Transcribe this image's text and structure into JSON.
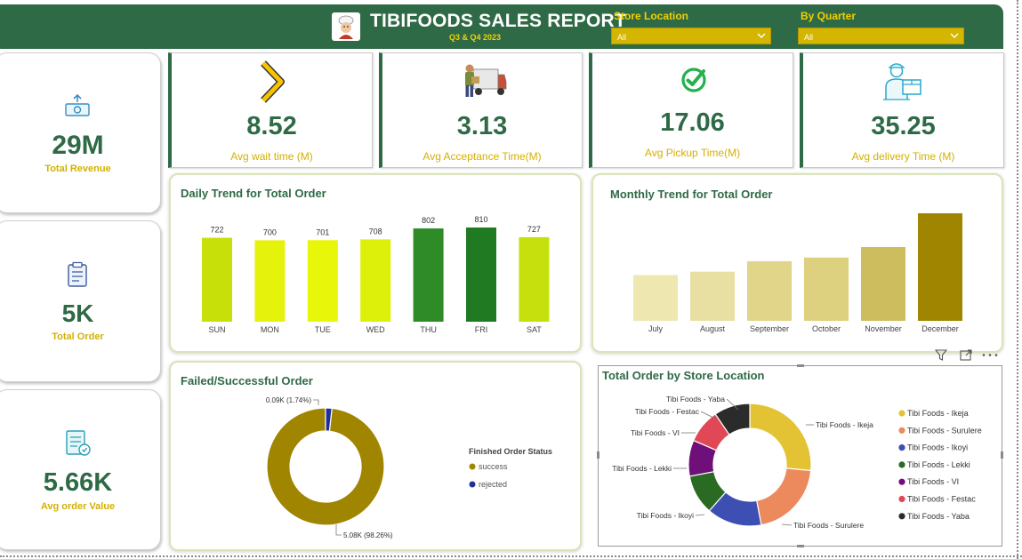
{
  "header": {
    "title": "TIBIFOODS SALES REPORT",
    "subtitle": "Q3 & Q4 2023",
    "logo_icon": "chef-logo-icon"
  },
  "slicers": [
    {
      "label": "Store Location",
      "value": "All"
    },
    {
      "label": "By Quarter",
      "value": "All"
    }
  ],
  "left_kpis": [
    {
      "value": "29M",
      "label": "Total Revenue",
      "icon": "money-icon"
    },
    {
      "value": "5K",
      "label": "Total Order",
      "icon": "clipboard-icon"
    },
    {
      "value": "5.66K",
      "label": "Avg order Value",
      "icon": "invoice-icon"
    }
  ],
  "top_kpis": [
    {
      "value": "8.52",
      "label": "Avg wait time (M)",
      "icon": "chevron-right-icon"
    },
    {
      "value": "3.13",
      "label": "Avg Acceptance Time(M)",
      "icon": "delivery-truck-icon"
    },
    {
      "value": "17.06",
      "label": "Avg Pickup Time(M)",
      "icon": "check-circle-icon"
    },
    {
      "value": "35.25",
      "label": "Avg delivery Time (M)",
      "icon": "delivery-person-icon"
    }
  ],
  "colors": {
    "brand_green": "#2f6a46",
    "accent_gold": "#d4b000",
    "success": "#a08500",
    "rejected": "#1f2f9c"
  },
  "visual_toolbar": {
    "icons": [
      "filter-icon",
      "focus-mode-icon",
      "more-options-icon"
    ]
  },
  "chart_data": [
    {
      "type": "bar",
      "title": "Daily Trend for Total Order",
      "categories": [
        "SUN",
        "MON",
        "TUE",
        "WED",
        "THU",
        "FRI",
        "SAT"
      ],
      "values": [
        722,
        700,
        701,
        708,
        802,
        810,
        727
      ],
      "data_labels": [
        "722",
        "700",
        "701",
        "708",
        "802",
        "810",
        "727"
      ],
      "colors": [
        "#c8e00a",
        "#e5f20c",
        "#e8f70a",
        "#ddf00a",
        "#2e8b27",
        "#1f7a21",
        "#c6e00e"
      ],
      "ylim": [
        0,
        810
      ]
    },
    {
      "type": "bar",
      "title": "Monthly Trend for Total Order",
      "categories": [
        "July",
        "August",
        "September",
        "October",
        "November",
        "December"
      ],
      "values": [
        745,
        800,
        970,
        1030,
        1200,
        1750
      ],
      "colors": [
        "#eee8b0",
        "#e8e0a2",
        "#e0d588",
        "#ddd07f",
        "#cdbd5e",
        "#a08500"
      ],
      "ylim": [
        0,
        1750
      ]
    },
    {
      "type": "pie",
      "title": "Failed/Successful Order",
      "legend_title": "Finished Order Status",
      "legend_position": "right",
      "slices": [
        {
          "name": "success",
          "value": 5.08,
          "label": "5.08K (98.26%)",
          "color": "#a08500"
        },
        {
          "name": "rejected",
          "value": 0.09,
          "label": "0.09K (1.74%)",
          "color": "#1f2f9c"
        }
      ]
    },
    {
      "type": "pie",
      "title": "Total Order by Store Location",
      "legend_position": "right",
      "slices": [
        {
          "name": "Tibi Foods - Ikeja",
          "value": 26.5,
          "color": "#e3c233"
        },
        {
          "name": "Tibi Foods - Surulere",
          "value": 20.5,
          "color": "#ec8a5e"
        },
        {
          "name": "Tibi Foods - Ikoyi",
          "value": 14.5,
          "color": "#3d4fb3"
        },
        {
          "name": "Tibi Foods - Lekki",
          "value": 10.5,
          "color": "#2a6a22"
        },
        {
          "name": "Tibi Foods - VI",
          "value": 9.5,
          "color": "#6e0f7a"
        },
        {
          "name": "Tibi Foods - Festac",
          "value": 9.0,
          "color": "#e04855"
        },
        {
          "name": "Tibi Foods - Yaba",
          "value": 9.5,
          "color": "#2b2b2b"
        }
      ]
    }
  ]
}
